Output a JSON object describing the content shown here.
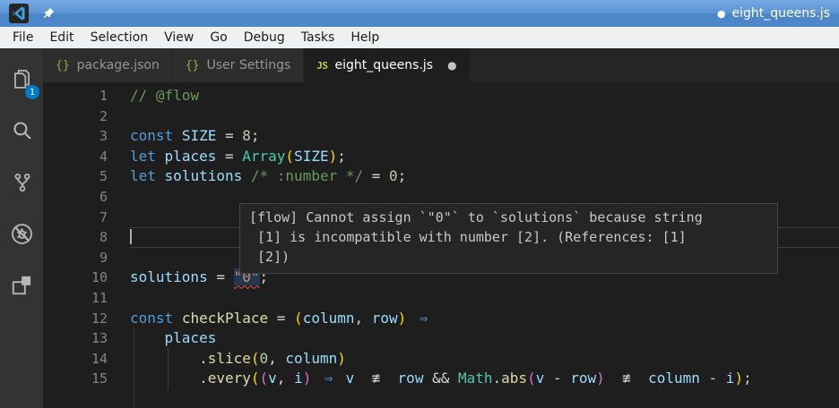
{
  "window": {
    "dot": "●",
    "title": "eight_queens.js"
  },
  "menu": {
    "items": [
      "File",
      "Edit",
      "Selection",
      "View",
      "Go",
      "Debug",
      "Tasks",
      "Help"
    ]
  },
  "activity_bar": {
    "items": [
      {
        "icon": "files-icon",
        "badge": "1"
      },
      {
        "icon": "search-icon"
      },
      {
        "icon": "source-control-icon"
      },
      {
        "icon": "debug-icon"
      },
      {
        "icon": "extensions-icon"
      }
    ]
  },
  "tabs": [
    {
      "icon": "{}",
      "icon_type": "json",
      "label": "package.json",
      "active": false,
      "modified": false
    },
    {
      "icon": "{}",
      "icon_type": "json",
      "label": "User Settings",
      "active": false,
      "modified": false
    },
    {
      "icon": "JS",
      "icon_type": "js",
      "label": "eight_queens.js",
      "active": true,
      "modified": true,
      "modified_dot": "●"
    }
  ],
  "editor": {
    "lines": [
      {
        "num": "1",
        "tokens": [
          {
            "t": "// @flow",
            "c": "cmt"
          }
        ]
      },
      {
        "num": "2",
        "tokens": []
      },
      {
        "num": "3",
        "tokens": [
          {
            "t": "const",
            "c": "kw"
          },
          {
            "t": " ",
            "c": "pln"
          },
          {
            "t": "SIZE",
            "c": "var"
          },
          {
            "t": " = ",
            "c": "pln"
          },
          {
            "t": "8",
            "c": "num"
          },
          {
            "t": ";",
            "c": "pln"
          }
        ]
      },
      {
        "num": "4",
        "tokens": [
          {
            "t": "let",
            "c": "kw"
          },
          {
            "t": " ",
            "c": "pln"
          },
          {
            "t": "places",
            "c": "var"
          },
          {
            "t": " = ",
            "c": "pln"
          },
          {
            "t": "Array",
            "c": "cls"
          },
          {
            "t": "(",
            "c": "br1"
          },
          {
            "t": "SIZE",
            "c": "var"
          },
          {
            "t": ")",
            "c": "br1"
          },
          {
            "t": ";",
            "c": "pln"
          }
        ]
      },
      {
        "num": "5",
        "tokens": [
          {
            "t": "let",
            "c": "kw"
          },
          {
            "t": " ",
            "c": "pln"
          },
          {
            "t": "solutions",
            "c": "var"
          },
          {
            "t": " ",
            "c": "pln"
          },
          {
            "t": "/* :number */",
            "c": "cmt"
          },
          {
            "t": " = ",
            "c": "pln"
          },
          {
            "t": "0",
            "c": "num"
          },
          {
            "t": ";",
            "c": "pln"
          }
        ]
      },
      {
        "num": "6",
        "tokens": []
      },
      {
        "num": "7",
        "tokens": []
      },
      {
        "num": "8",
        "cursor": true,
        "current": true,
        "tokens": []
      },
      {
        "num": "9",
        "tokens": []
      },
      {
        "num": "10",
        "tokens": [
          {
            "t": "solutions",
            "c": "var"
          },
          {
            "t": " = ",
            "c": "pln"
          },
          {
            "t": "\"0\"",
            "c": "str",
            "x": "err"
          },
          {
            "t": ";",
            "c": "pln"
          }
        ]
      },
      {
        "num": "11",
        "tokens": []
      },
      {
        "num": "12",
        "tokens": [
          {
            "t": "const",
            "c": "kw"
          },
          {
            "t": " ",
            "c": "pln"
          },
          {
            "t": "checkPlace",
            "c": "fn"
          },
          {
            "t": " = ",
            "c": "pln"
          },
          {
            "t": "(",
            "c": "br1"
          },
          {
            "t": "column",
            "c": "var"
          },
          {
            "t": ", ",
            "c": "pln"
          },
          {
            "t": "row",
            "c": "var"
          },
          {
            "t": ")",
            "c": "br1"
          },
          {
            "t": " ",
            "c": "pln"
          },
          {
            "t": "⇒",
            "c": "kw",
            "x": "lig2"
          }
        ]
      },
      {
        "num": "13",
        "guides": [
          4
        ],
        "tokens": [
          {
            "t": "    ",
            "c": "pln"
          },
          {
            "t": "places",
            "c": "var"
          }
        ]
      },
      {
        "num": "14",
        "guides": [
          4,
          42
        ],
        "tokens": [
          {
            "t": "        ",
            "c": "pln"
          },
          {
            "t": ".",
            "c": "pln"
          },
          {
            "t": "slice",
            "c": "fn"
          },
          {
            "t": "(",
            "c": "br1"
          },
          {
            "t": "0",
            "c": "num"
          },
          {
            "t": ", ",
            "c": "pln"
          },
          {
            "t": "column",
            "c": "var"
          },
          {
            "t": ")",
            "c": "br1"
          }
        ]
      },
      {
        "num": "15",
        "guides": [
          4,
          42
        ],
        "tokens": [
          {
            "t": "        ",
            "c": "pln"
          },
          {
            "t": ".",
            "c": "pln"
          },
          {
            "t": "every",
            "c": "fn"
          },
          {
            "t": "(",
            "c": "br1"
          },
          {
            "t": "(",
            "c": "br2"
          },
          {
            "t": "v",
            "c": "var"
          },
          {
            "t": ", ",
            "c": "pln"
          },
          {
            "t": "i",
            "c": "var"
          },
          {
            "t": ")",
            "c": "br2"
          },
          {
            "t": " ",
            "c": "pln"
          },
          {
            "t": "⇒",
            "c": "kw",
            "x": "lig2"
          },
          {
            "t": " ",
            "c": "pln"
          },
          {
            "t": "v",
            "c": "var"
          },
          {
            "t": " ",
            "c": "pln"
          },
          {
            "t": "≢",
            "c": "pln",
            "x": "lig3"
          },
          {
            "t": " ",
            "c": "pln"
          },
          {
            "t": "row",
            "c": "var"
          },
          {
            "t": " ",
            "c": "pln"
          },
          {
            "t": "&&",
            "c": "pln"
          },
          {
            "t": " ",
            "c": "pln"
          },
          {
            "t": "Math",
            "c": "cls"
          },
          {
            "t": ".",
            "c": "pln"
          },
          {
            "t": "abs",
            "c": "fn"
          },
          {
            "t": "(",
            "c": "br2"
          },
          {
            "t": "v",
            "c": "var"
          },
          {
            "t": " - ",
            "c": "pln"
          },
          {
            "t": "row",
            "c": "var"
          },
          {
            "t": ")",
            "c": "br2"
          },
          {
            "t": " ",
            "c": "pln"
          },
          {
            "t": "≢",
            "c": "pln",
            "x": "lig3"
          },
          {
            "t": " ",
            "c": "pln"
          },
          {
            "t": "column",
            "c": "var"
          },
          {
            "t": " - ",
            "c": "pln"
          },
          {
            "t": "i",
            "c": "var"
          },
          {
            "t": ")",
            "c": "br1"
          },
          {
            "t": ";",
            "c": "pln"
          }
        ]
      },
      {
        "num": "",
        "guides": [
          4
        ],
        "tokens": []
      }
    ],
    "tooltip": {
      "lines": [
        "[flow] Cannot assign `\"0\"` to `solutions` because string",
        " [1] is incompatible with number [2]. (References: [1]",
        " [2])"
      ]
    }
  },
  "colors": {
    "accent": "#007acc",
    "error_squiggle": "#f14c4c",
    "hover_highlight": "#264f78",
    "syntax": {
      "kw": "#569cd6",
      "var": "#9cdcfe",
      "fn": "#dcdcaa",
      "cls": "#4ec9b0",
      "num": "#b5cea8",
      "str": "#ce9178",
      "cmt": "#6a9955",
      "pln": "#d4d4d4",
      "br1": "#ffd700",
      "br2": "#da70d6"
    }
  }
}
